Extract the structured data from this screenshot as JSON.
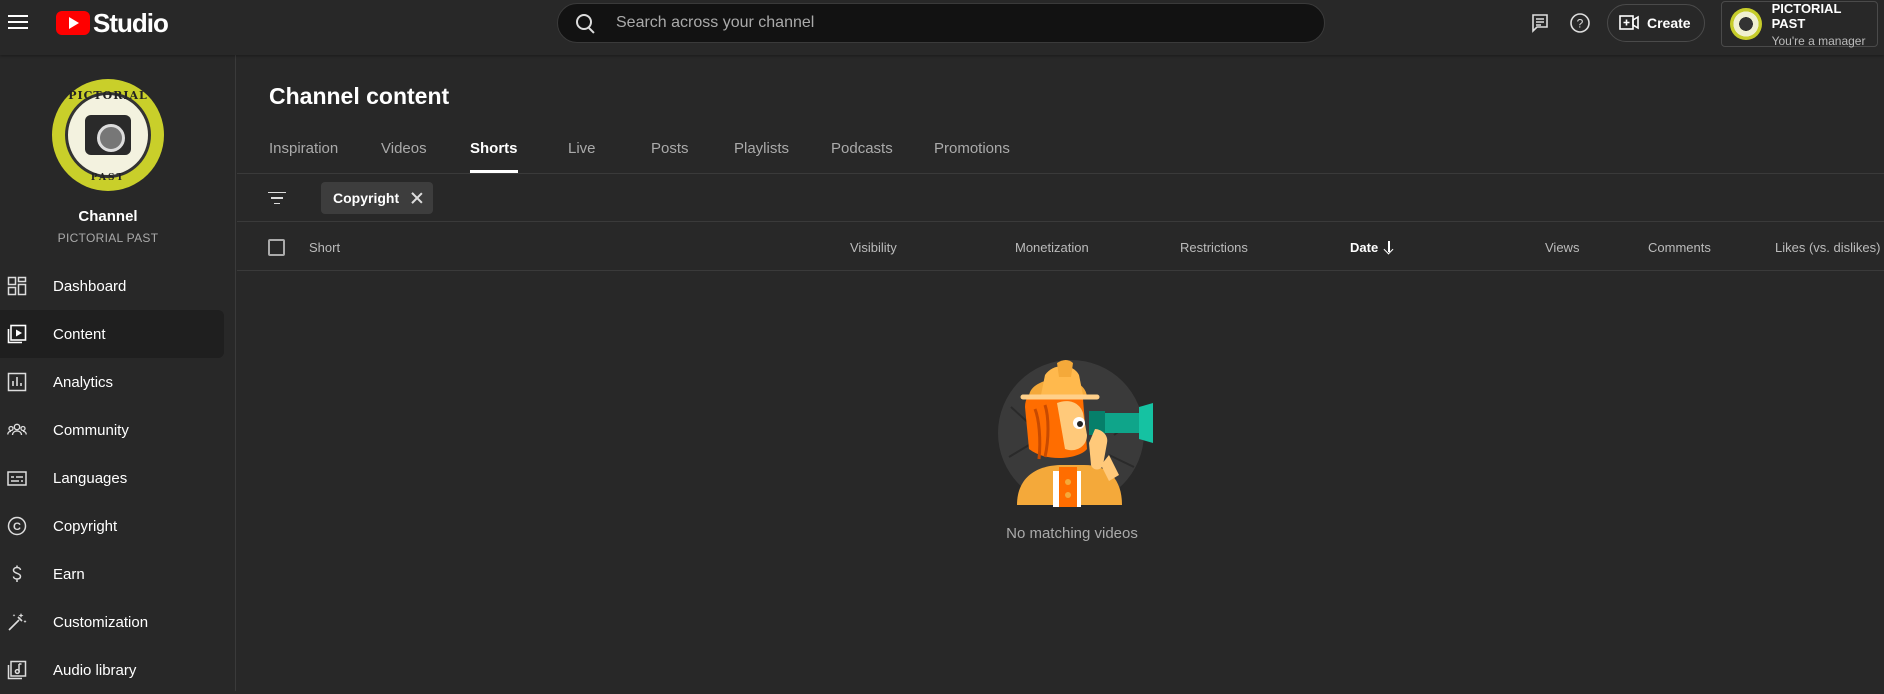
{
  "topbar": {
    "logo_text": "Studio",
    "search_placeholder": "Search across your channel",
    "create_label": "Create",
    "account_name": "PICTORIAL PAST",
    "account_role": "You're a manager"
  },
  "sidebar": {
    "channel_title": "Channel",
    "channel_name": "PICTORIAL PAST",
    "avatar_top_text": "PICTORIAL",
    "avatar_bottom_text": "PAST",
    "items": [
      {
        "label": "Dashboard",
        "icon": "dashboard-icon"
      },
      {
        "label": "Content",
        "icon": "content-icon",
        "active": true
      },
      {
        "label": "Analytics",
        "icon": "analytics-icon"
      },
      {
        "label": "Community",
        "icon": "community-icon"
      },
      {
        "label": "Languages",
        "icon": "languages-icon"
      },
      {
        "label": "Copyright",
        "icon": "copyright-icon"
      },
      {
        "label": "Earn",
        "icon": "earn-icon"
      },
      {
        "label": "Customization",
        "icon": "customization-icon"
      },
      {
        "label": "Audio library",
        "icon": "audio-library-icon"
      }
    ]
  },
  "main": {
    "title": "Channel content",
    "tabs": [
      {
        "label": "Inspiration"
      },
      {
        "label": "Videos"
      },
      {
        "label": "Shorts",
        "active": true
      },
      {
        "label": "Live"
      },
      {
        "label": "Posts"
      },
      {
        "label": "Playlists"
      },
      {
        "label": "Podcasts"
      },
      {
        "label": "Promotions"
      }
    ],
    "filter_chip": "Copyright",
    "columns": {
      "short": "Short",
      "visibility": "Visibility",
      "monetization": "Monetization",
      "restrictions": "Restrictions",
      "date": "Date",
      "views": "Views",
      "comments": "Comments",
      "likes": "Likes (vs. dislikes)"
    },
    "empty_message": "No matching videos"
  },
  "colors": {
    "background": "#282828",
    "brand_red": "#ff0000",
    "active_nav": "#1f1f1f"
  }
}
